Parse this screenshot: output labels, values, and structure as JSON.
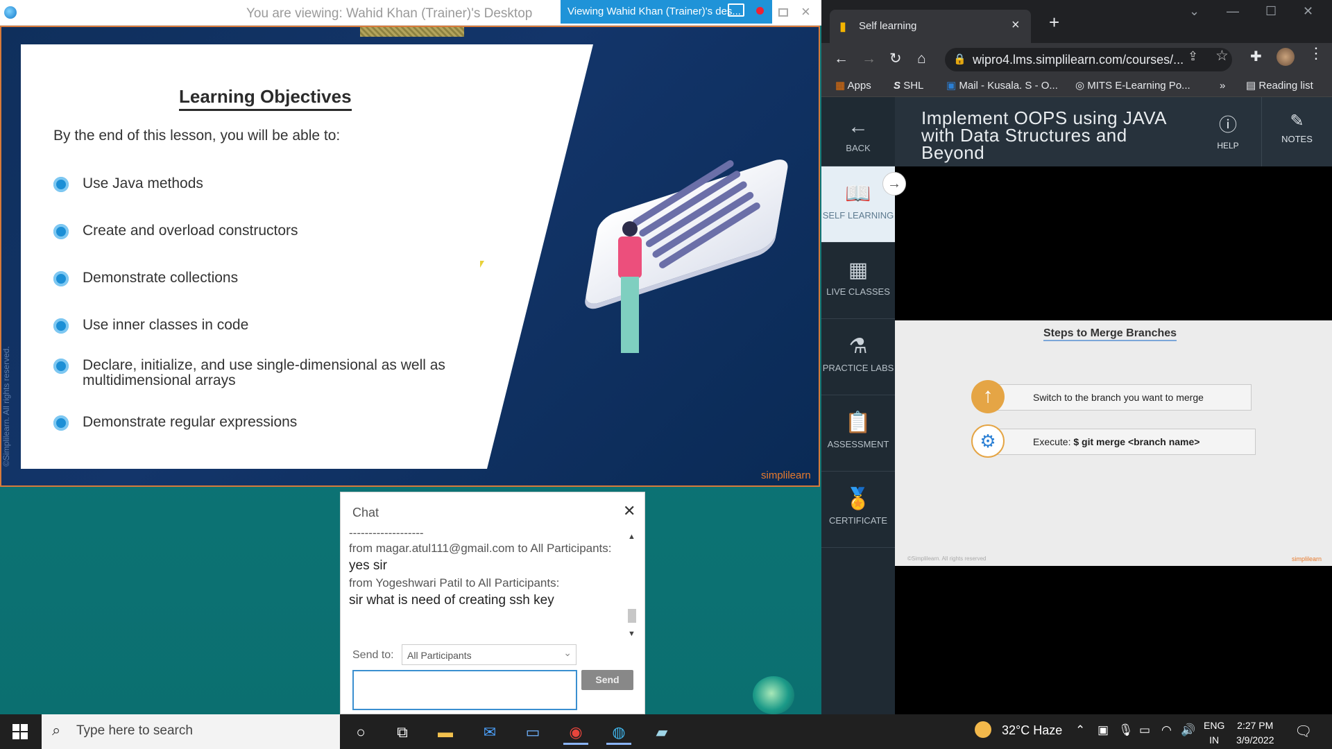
{
  "webex": {
    "title": "You are viewing: Wahid Khan (Trainer)'s Desktop",
    "viewing_banner": "Viewing Wahid Khan (Trainer)'s des...",
    "slide": {
      "title": "Learning Objectives",
      "intro": "By the end of this lesson, you will be able to:",
      "objectives": [
        "Use Java methods",
        "Create and overload constructors",
        "Demonstrate collections",
        "Use inner classes in code",
        "Declare, initialize, and use single-dimensional as well as multidimensional arrays",
        "Demonstrate regular expressions"
      ],
      "brand": "simplilearn",
      "side_copyright": "©Simplilearn. All rights reserved."
    },
    "chat": {
      "title": "Chat",
      "divider": "-------------------",
      "messages": [
        {
          "from": "from magar.atul111@gmail.com to All Participants:",
          "text": "yes sir"
        },
        {
          "from": "from Yogeshwari Patil to All Participants:",
          "text": "sir what is need of creating ssh key"
        }
      ],
      "send_to_label": "Send to:",
      "send_to_value": "All Participants",
      "send_label": "Send"
    }
  },
  "browser": {
    "tab_title": "Self learning",
    "url": "wipro4.lms.simplilearn.com/courses/...",
    "bookmarks": [
      "Apps",
      "SHL",
      "Mail - Kusala. S - O...",
      "MITS E-Learning Po...",
      "»",
      "Reading list"
    ]
  },
  "lms": {
    "back": "BACK",
    "course_title": "Implement OOPS using JAVA with Data Structures and Beyond",
    "help": "HELP",
    "notes": "NOTES",
    "sidebar": [
      {
        "label": "SELF LEARNING",
        "icon": "book-icon"
      },
      {
        "label": "LIVE CLASSES",
        "icon": "calendar-icon"
      },
      {
        "label": "PRACTICE LABS",
        "icon": "flask-icon"
      },
      {
        "label": "ASSESSMENT",
        "icon": "clipboard-icon"
      },
      {
        "label": "CERTIFICATE",
        "icon": "certificate-icon"
      }
    ],
    "lesson": {
      "title": "Steps to Merge Branches",
      "step1": "Switch to the branch you want to merge",
      "step2_prefix": "Execute: ",
      "step2_cmd": "$ git merge <branch name>",
      "footer_left": "©Simplilearn. All rights reserved",
      "footer_right": "simplilearn"
    }
  },
  "taskbar": {
    "search_placeholder": "Type here to search",
    "weather": "32°C  Haze",
    "lang_top": "ENG",
    "lang_bottom": "IN",
    "time": "2:27 PM",
    "date": "3/9/2022"
  }
}
